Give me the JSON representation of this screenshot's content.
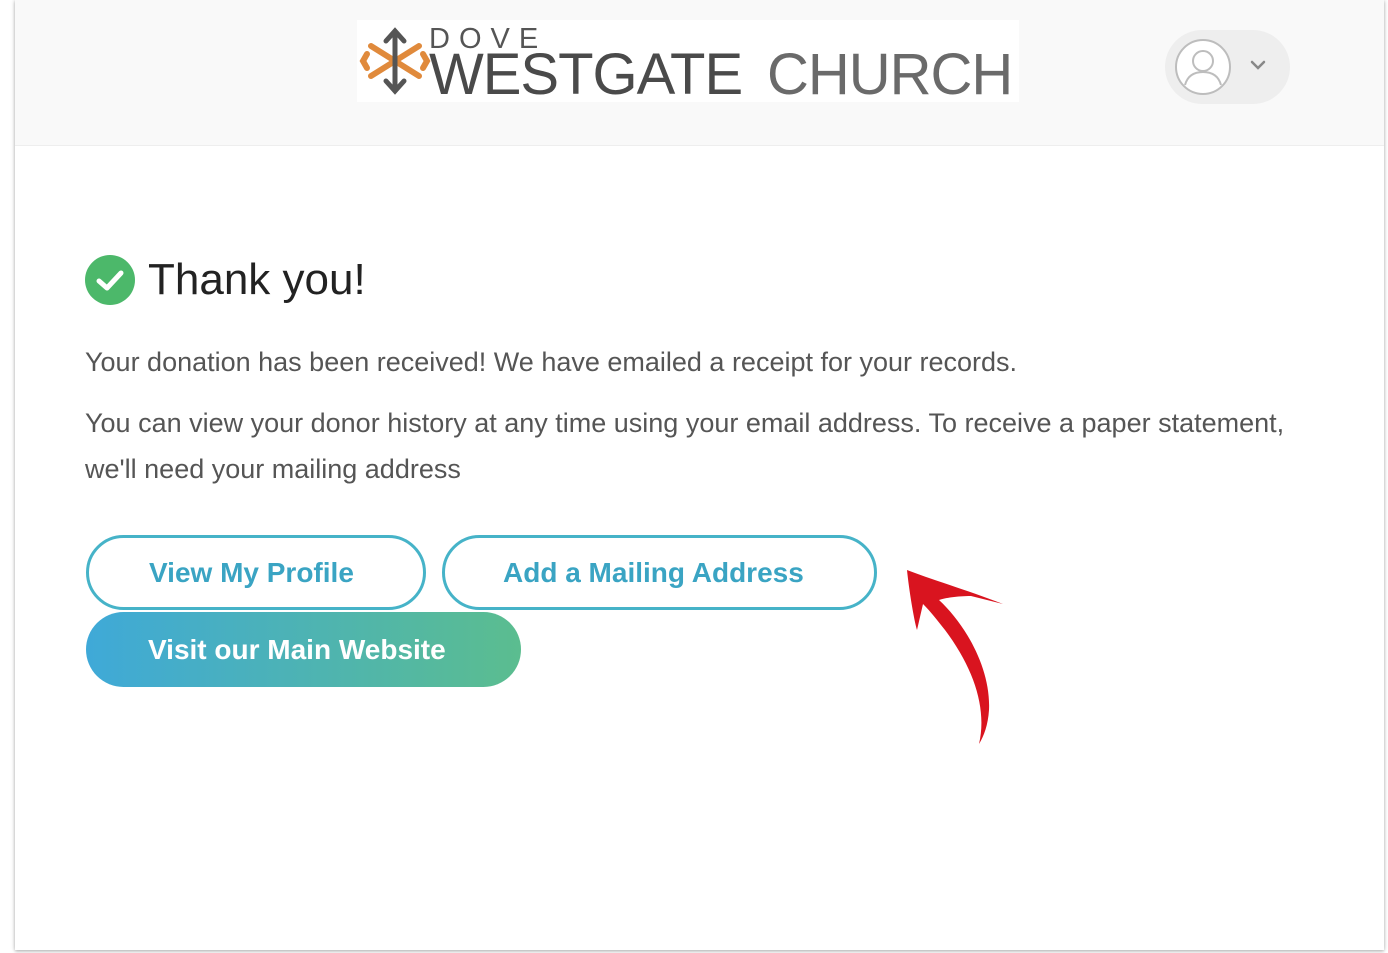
{
  "header": {
    "logo": {
      "line1": "DOVE",
      "line2a": "WESTGATE",
      "line2b": "CHURCH"
    },
    "user_menu": {
      "avatar_icon": "user-avatar-icon",
      "chevron_icon": "chevron-down-icon"
    }
  },
  "main": {
    "title": "Thank you!",
    "title_icon": "check-circle-icon",
    "paragraph1": "Your donation has been received! We have emailed a receipt for your records.",
    "paragraph2": "You can view your donor history at any time using your email address. To receive a paper statement, we'll need your mailing address",
    "buttons": {
      "view_profile": "View My Profile",
      "add_mailing": "Add a Mailing Address",
      "visit_site": "Visit our Main Website"
    }
  },
  "colors": {
    "success": "#4cb86a",
    "outline_button": "#46b3c8",
    "gradient_start": "#3fa9d8",
    "gradient_end": "#5bbd8f",
    "annotation_arrow": "#d9141f"
  }
}
